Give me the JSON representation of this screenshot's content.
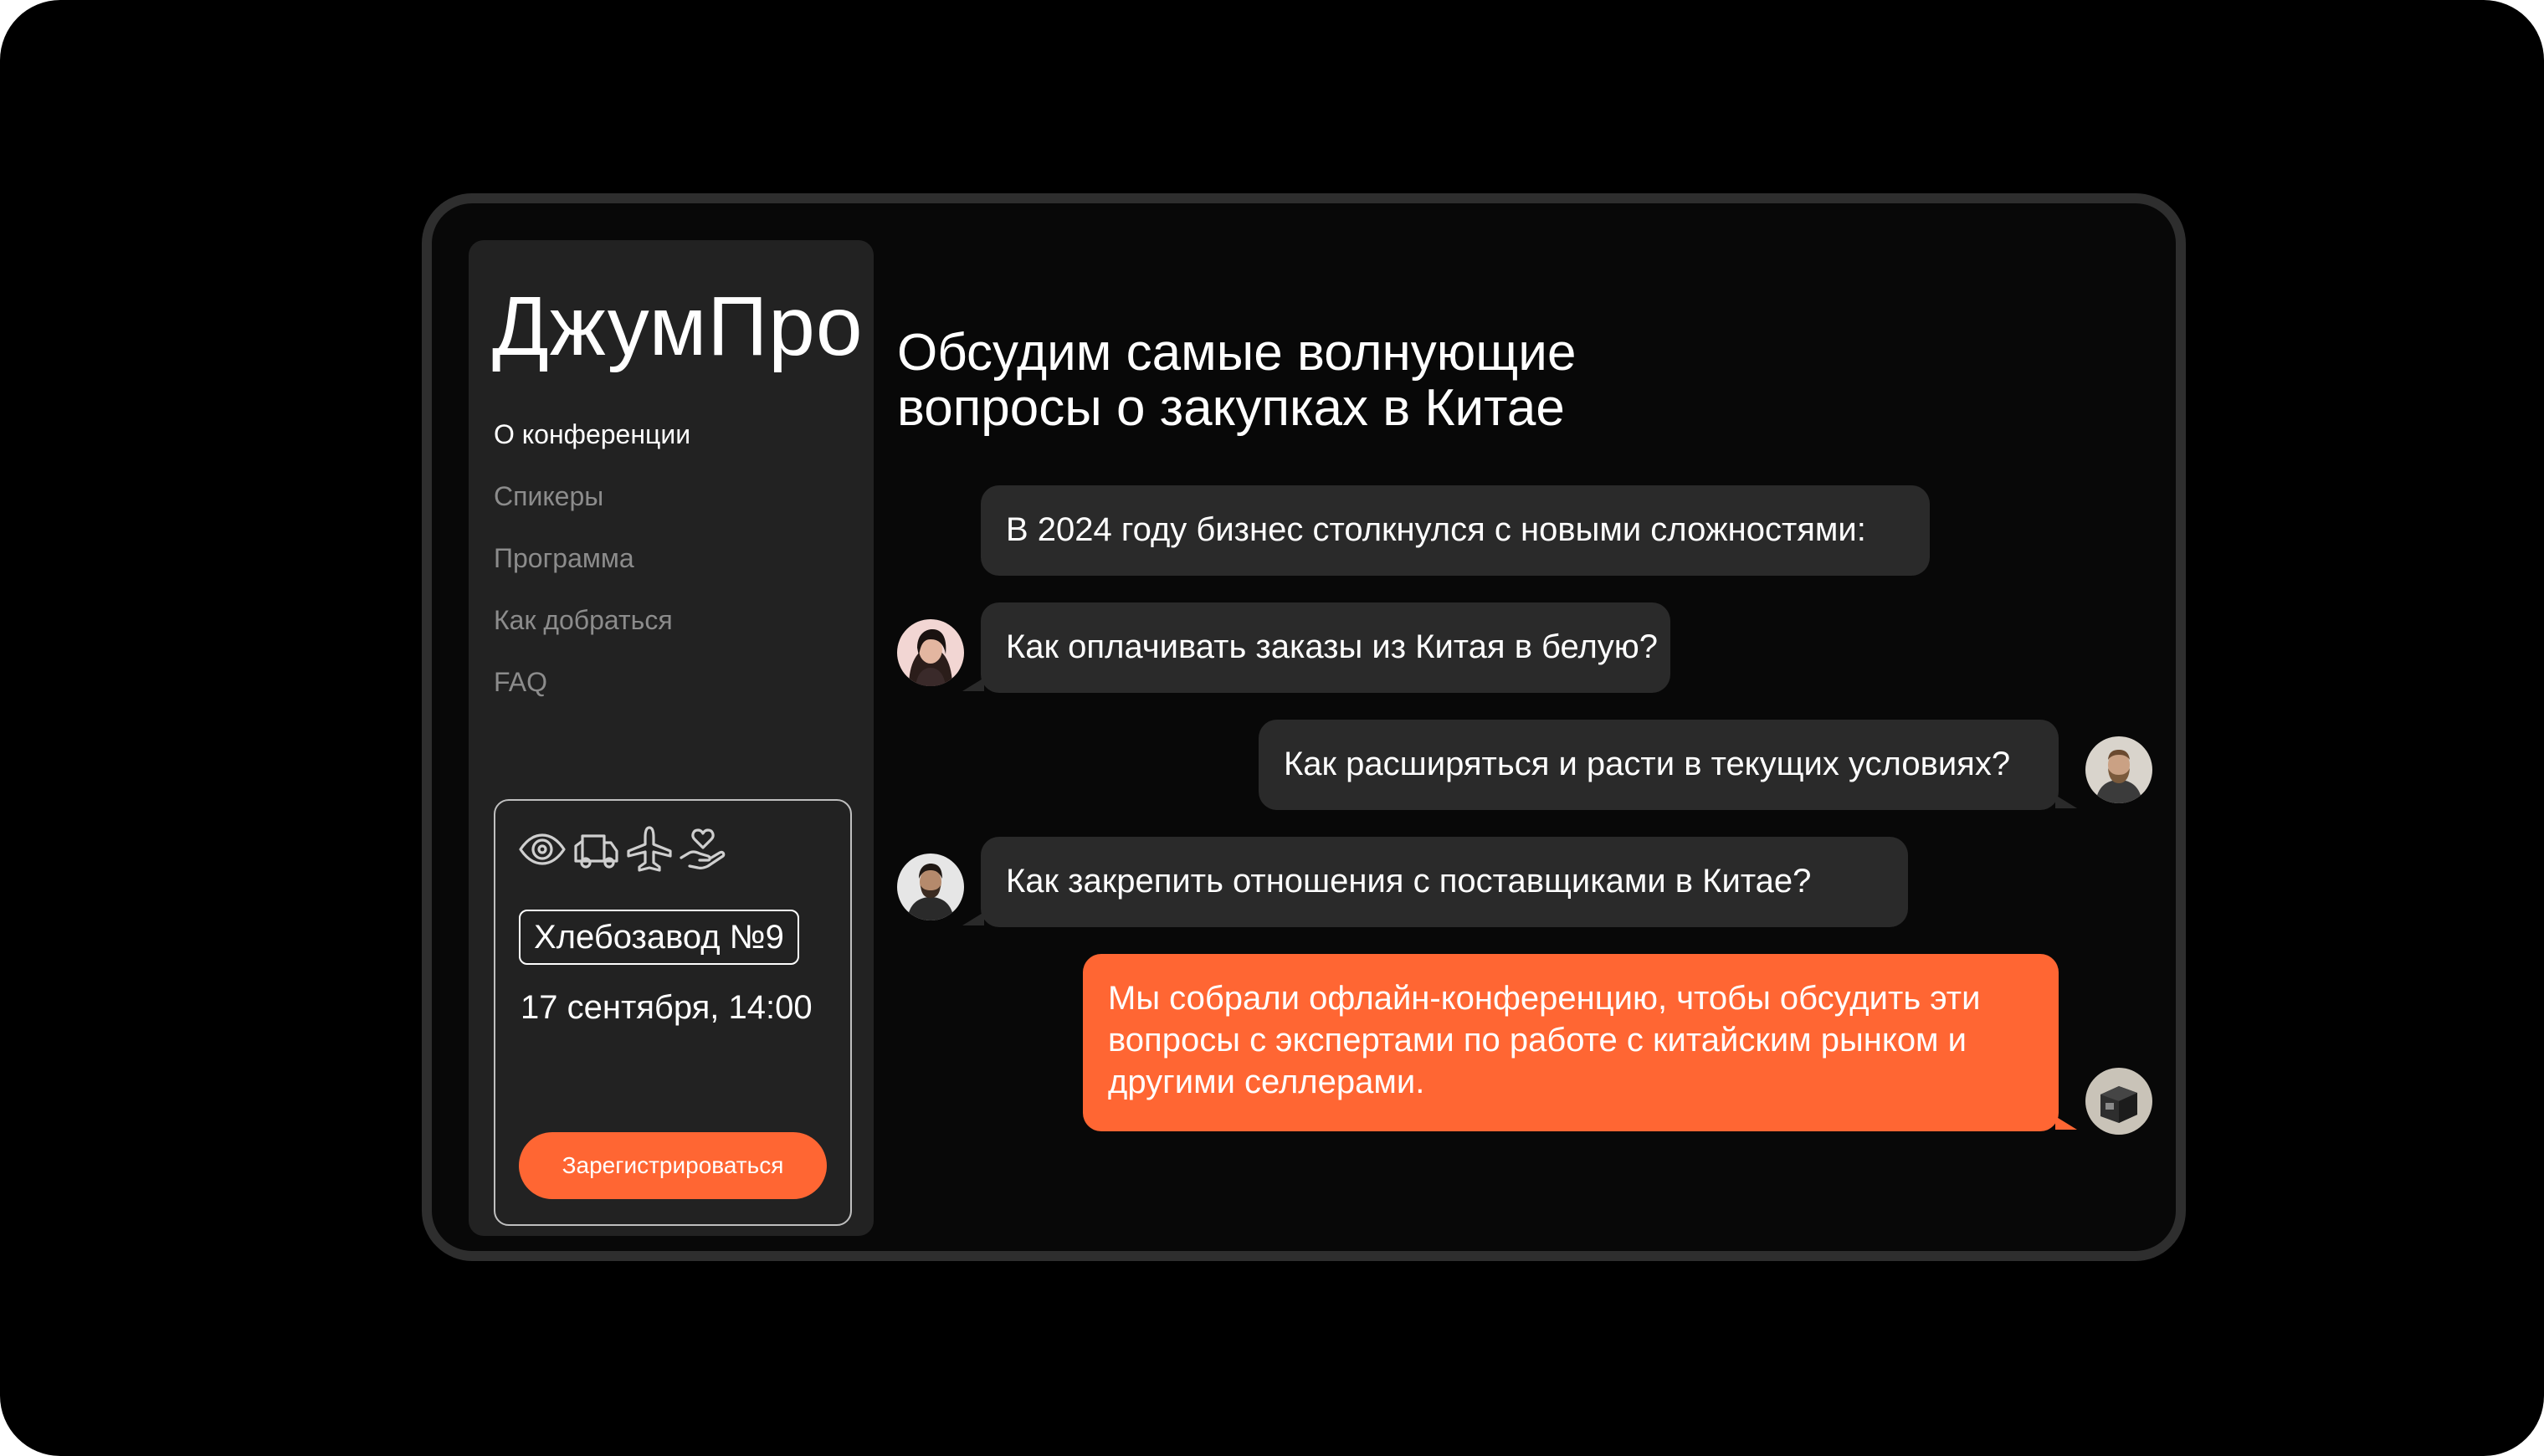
{
  "app": {
    "logo": "ДжумПро"
  },
  "nav": {
    "items": [
      {
        "label": "О конференции",
        "active": true
      },
      {
        "label": "Спикеры",
        "active": false
      },
      {
        "label": "Программа",
        "active": false
      },
      {
        "label": "Как добраться",
        "active": false
      },
      {
        "label": "FAQ",
        "active": false
      }
    ]
  },
  "event": {
    "icons": [
      "eye-icon",
      "truck-icon",
      "plane-icon",
      "hand-heart-icon"
    ],
    "venue": "Хлебозавод №9",
    "date": "17 сентября, 14:00",
    "register_label": "Зарегистрироваться"
  },
  "main": {
    "headline_line1": "Обсудим самые волнующие",
    "headline_line2": "вопросы о закупках в Китае",
    "messages": [
      {
        "text": "В 2024 году бизнес столкнулся с новыми сложностями:"
      },
      {
        "text": "Как оплачивать заказы из Китая в белую?"
      },
      {
        "text": "Как расширяться и расти в текущих условиях?"
      },
      {
        "text": "Как закрепить отношения с поставщиками в Китае?"
      },
      {
        "text": "Мы собрали офлайн-конференцию, чтобы обсудить эти вопросы с экспертами по работе с китайским рынком и другими селлерами."
      }
    ]
  },
  "colors": {
    "accent": "#ff6633",
    "background": "#000000",
    "panel": "#222222",
    "bubble": "#2a2a2a",
    "frame": "#2e2e2e"
  }
}
